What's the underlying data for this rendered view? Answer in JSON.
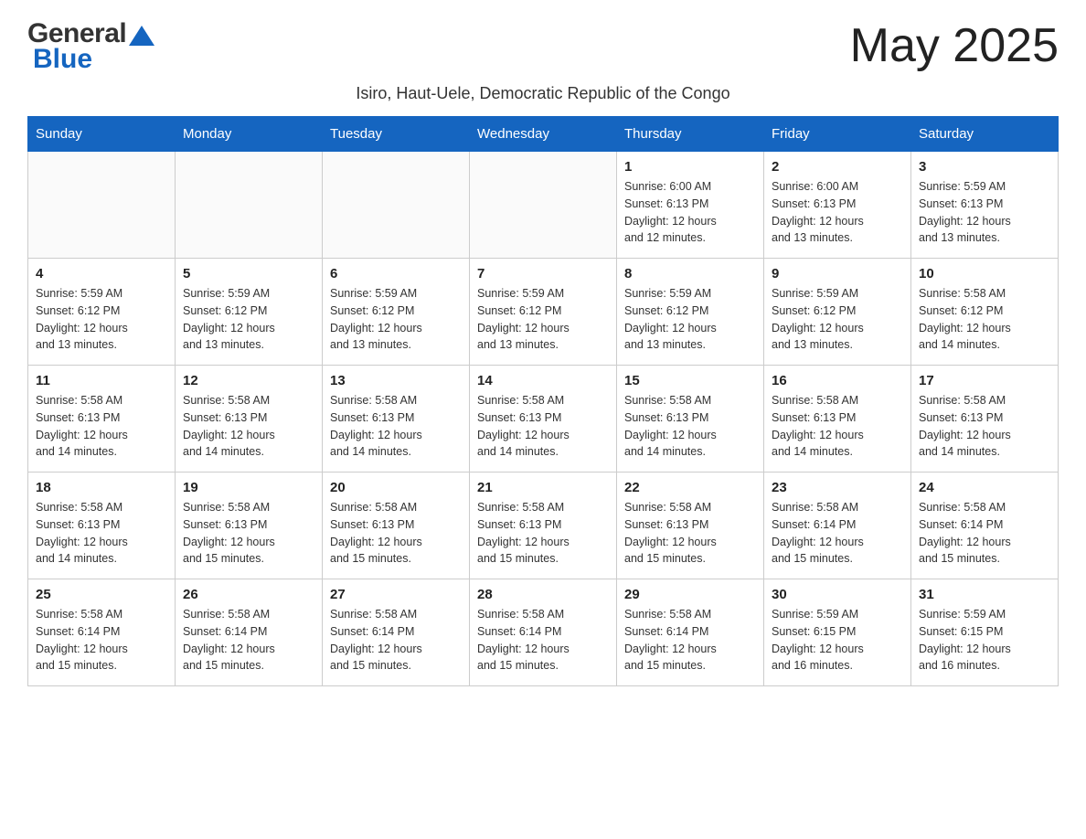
{
  "header": {
    "logo_general": "General",
    "logo_blue": "Blue",
    "month_title": "May 2025",
    "subtitle": "Isiro, Haut-Uele, Democratic Republic of the Congo"
  },
  "weekdays": [
    "Sunday",
    "Monday",
    "Tuesday",
    "Wednesday",
    "Thursday",
    "Friday",
    "Saturday"
  ],
  "weeks": [
    [
      {
        "day": "",
        "info": ""
      },
      {
        "day": "",
        "info": ""
      },
      {
        "day": "",
        "info": ""
      },
      {
        "day": "",
        "info": ""
      },
      {
        "day": "1",
        "info": "Sunrise: 6:00 AM\nSunset: 6:13 PM\nDaylight: 12 hours\nand 12 minutes."
      },
      {
        "day": "2",
        "info": "Sunrise: 6:00 AM\nSunset: 6:13 PM\nDaylight: 12 hours\nand 13 minutes."
      },
      {
        "day": "3",
        "info": "Sunrise: 5:59 AM\nSunset: 6:13 PM\nDaylight: 12 hours\nand 13 minutes."
      }
    ],
    [
      {
        "day": "4",
        "info": "Sunrise: 5:59 AM\nSunset: 6:12 PM\nDaylight: 12 hours\nand 13 minutes."
      },
      {
        "day": "5",
        "info": "Sunrise: 5:59 AM\nSunset: 6:12 PM\nDaylight: 12 hours\nand 13 minutes."
      },
      {
        "day": "6",
        "info": "Sunrise: 5:59 AM\nSunset: 6:12 PM\nDaylight: 12 hours\nand 13 minutes."
      },
      {
        "day": "7",
        "info": "Sunrise: 5:59 AM\nSunset: 6:12 PM\nDaylight: 12 hours\nand 13 minutes."
      },
      {
        "day": "8",
        "info": "Sunrise: 5:59 AM\nSunset: 6:12 PM\nDaylight: 12 hours\nand 13 minutes."
      },
      {
        "day": "9",
        "info": "Sunrise: 5:59 AM\nSunset: 6:12 PM\nDaylight: 12 hours\nand 13 minutes."
      },
      {
        "day": "10",
        "info": "Sunrise: 5:58 AM\nSunset: 6:12 PM\nDaylight: 12 hours\nand 14 minutes."
      }
    ],
    [
      {
        "day": "11",
        "info": "Sunrise: 5:58 AM\nSunset: 6:13 PM\nDaylight: 12 hours\nand 14 minutes."
      },
      {
        "day": "12",
        "info": "Sunrise: 5:58 AM\nSunset: 6:13 PM\nDaylight: 12 hours\nand 14 minutes."
      },
      {
        "day": "13",
        "info": "Sunrise: 5:58 AM\nSunset: 6:13 PM\nDaylight: 12 hours\nand 14 minutes."
      },
      {
        "day": "14",
        "info": "Sunrise: 5:58 AM\nSunset: 6:13 PM\nDaylight: 12 hours\nand 14 minutes."
      },
      {
        "day": "15",
        "info": "Sunrise: 5:58 AM\nSunset: 6:13 PM\nDaylight: 12 hours\nand 14 minutes."
      },
      {
        "day": "16",
        "info": "Sunrise: 5:58 AM\nSunset: 6:13 PM\nDaylight: 12 hours\nand 14 minutes."
      },
      {
        "day": "17",
        "info": "Sunrise: 5:58 AM\nSunset: 6:13 PM\nDaylight: 12 hours\nand 14 minutes."
      }
    ],
    [
      {
        "day": "18",
        "info": "Sunrise: 5:58 AM\nSunset: 6:13 PM\nDaylight: 12 hours\nand 14 minutes."
      },
      {
        "day": "19",
        "info": "Sunrise: 5:58 AM\nSunset: 6:13 PM\nDaylight: 12 hours\nand 15 minutes."
      },
      {
        "day": "20",
        "info": "Sunrise: 5:58 AM\nSunset: 6:13 PM\nDaylight: 12 hours\nand 15 minutes."
      },
      {
        "day": "21",
        "info": "Sunrise: 5:58 AM\nSunset: 6:13 PM\nDaylight: 12 hours\nand 15 minutes."
      },
      {
        "day": "22",
        "info": "Sunrise: 5:58 AM\nSunset: 6:13 PM\nDaylight: 12 hours\nand 15 minutes."
      },
      {
        "day": "23",
        "info": "Sunrise: 5:58 AM\nSunset: 6:14 PM\nDaylight: 12 hours\nand 15 minutes."
      },
      {
        "day": "24",
        "info": "Sunrise: 5:58 AM\nSunset: 6:14 PM\nDaylight: 12 hours\nand 15 minutes."
      }
    ],
    [
      {
        "day": "25",
        "info": "Sunrise: 5:58 AM\nSunset: 6:14 PM\nDaylight: 12 hours\nand 15 minutes."
      },
      {
        "day": "26",
        "info": "Sunrise: 5:58 AM\nSunset: 6:14 PM\nDaylight: 12 hours\nand 15 minutes."
      },
      {
        "day": "27",
        "info": "Sunrise: 5:58 AM\nSunset: 6:14 PM\nDaylight: 12 hours\nand 15 minutes."
      },
      {
        "day": "28",
        "info": "Sunrise: 5:58 AM\nSunset: 6:14 PM\nDaylight: 12 hours\nand 15 minutes."
      },
      {
        "day": "29",
        "info": "Sunrise: 5:58 AM\nSunset: 6:14 PM\nDaylight: 12 hours\nand 15 minutes."
      },
      {
        "day": "30",
        "info": "Sunrise: 5:59 AM\nSunset: 6:15 PM\nDaylight: 12 hours\nand 16 minutes."
      },
      {
        "day": "31",
        "info": "Sunrise: 5:59 AM\nSunset: 6:15 PM\nDaylight: 12 hours\nand 16 minutes."
      }
    ]
  ]
}
